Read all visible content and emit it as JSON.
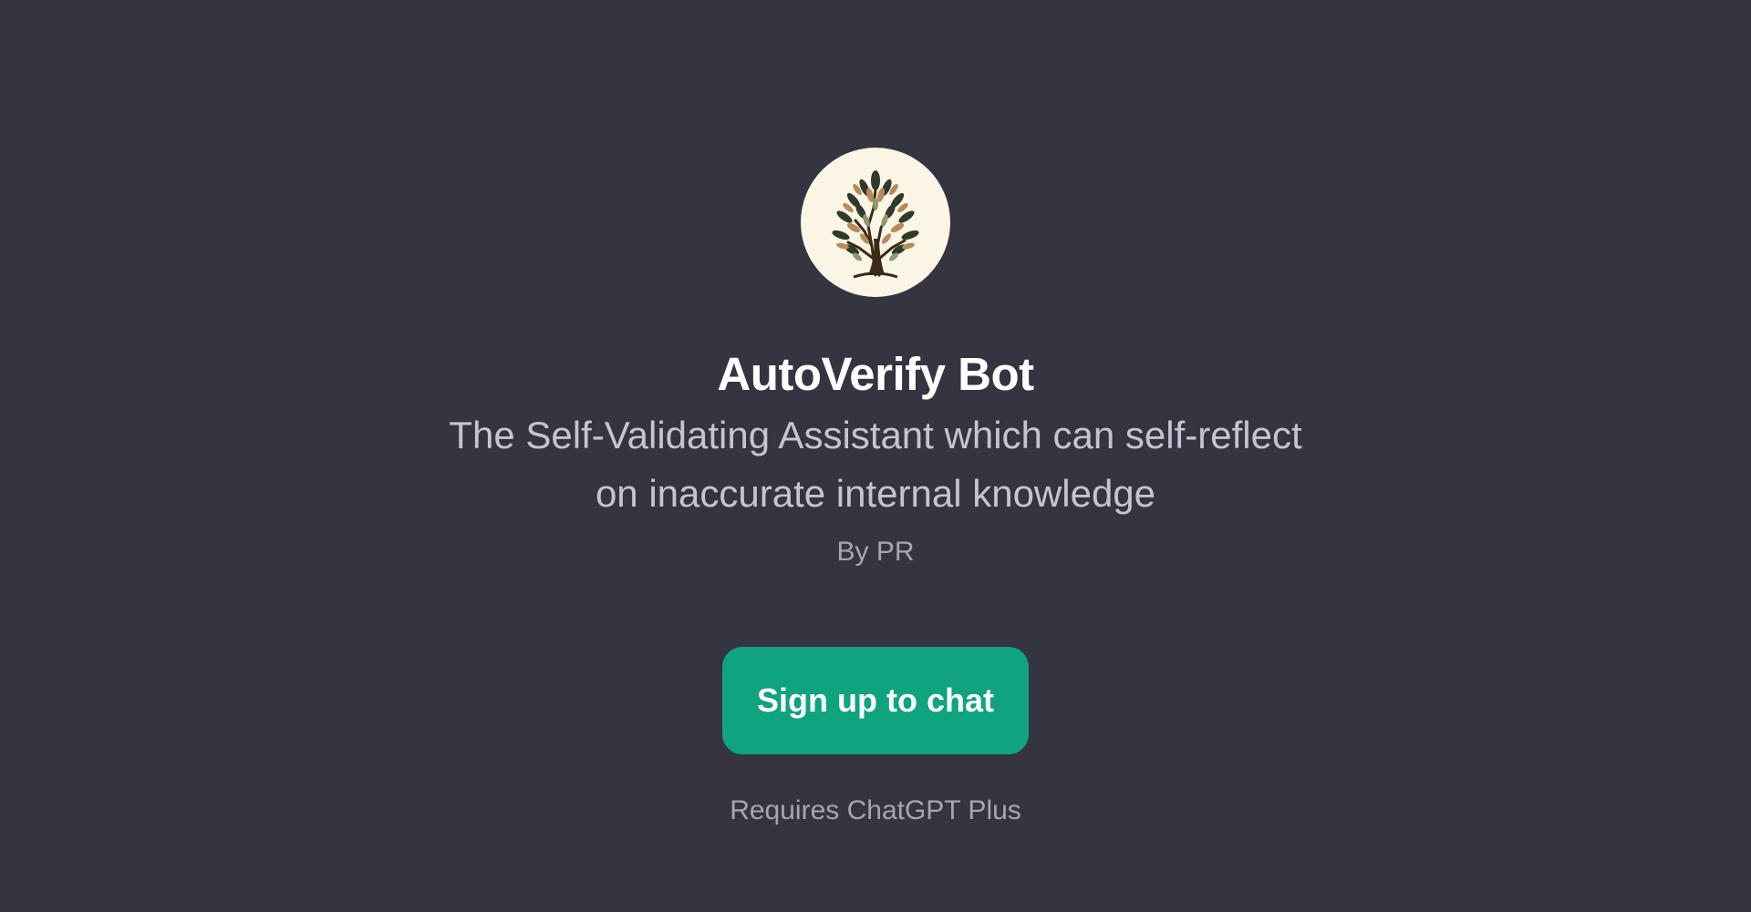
{
  "gpt": {
    "name": "AutoVerify Bot",
    "description": "The Self-Validating Assistant which can self-reflect on inaccurate internal knowledge",
    "author": "By PR",
    "avatar_icon": "tree-icon"
  },
  "cta": {
    "signup_label": "Sign up to chat",
    "requirement": "Requires ChatGPT Plus"
  },
  "colors": {
    "background": "#343541",
    "button": "#10a37f",
    "avatar_background": "#fbf5e6"
  }
}
